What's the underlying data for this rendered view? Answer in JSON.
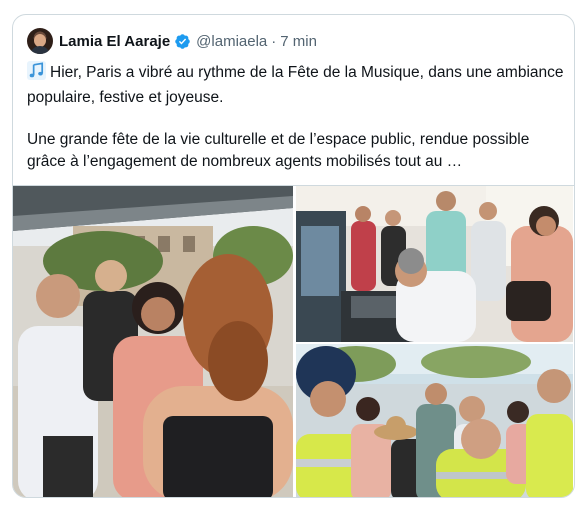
{
  "tweet": {
    "author_name": "Lamia El Aaraje",
    "handle": "@lamiaela",
    "separator": "·",
    "time": "7 min",
    "verified": true,
    "icon": "musical-notes-icon",
    "paragraph_1": "Hier, Paris a vibré au rythme de la Fête de la Musique, dans une ambiance populaire, festive et joyeuse.",
    "paragraph_2": "Une grande fête de la vie culturelle et de l’espace public, rendue possible grâce à l’engagement de nombreux agents mobilisés tout au …"
  },
  "colors": {
    "verified_blue": "#1d9bf0",
    "secondary_text": "#536471",
    "border": "#cfd9de"
  },
  "media": {
    "count": 3
  }
}
